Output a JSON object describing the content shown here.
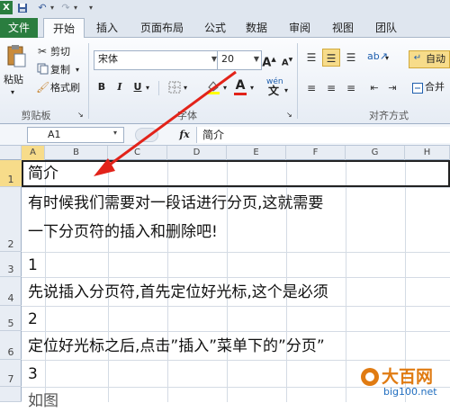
{
  "quick_access": {
    "excel_logo": "X",
    "undo": "↶",
    "redo": "↷",
    "dropdown": "▾"
  },
  "tabs": [
    "文件",
    "开始",
    "插入",
    "页面布局",
    "公式",
    "数据",
    "审阅",
    "视图",
    "团队"
  ],
  "active_tab": "开始",
  "clipboard": {
    "paste_label": "粘贴",
    "cut_label": "剪切",
    "copy_label": "复制",
    "format_painter_label": "格式刷",
    "group_label": "剪贴板"
  },
  "font": {
    "font_name": "宋体",
    "font_size": "20",
    "group_label": "字体",
    "bold": "B",
    "italic": "I",
    "underline": "U",
    "grow_font": "A",
    "shrink_font": "A",
    "font_color_letter": "A",
    "phonetic": "wén"
  },
  "alignment": {
    "group_label": "对齐方式",
    "wrap_label": "自动",
    "merge_label": "合并"
  },
  "formula_bar": {
    "name_box": "A1",
    "fx_label": "fx",
    "content": "简介"
  },
  "columns": [
    "A",
    "B",
    "C",
    "D",
    "E",
    "F",
    "G",
    "H"
  ],
  "rows": [
    {
      "number": "1",
      "text": "简介"
    },
    {
      "number": "2",
      "text": "有时候我们需要对一段话进行分页,这就需要"
    },
    {
      "number": "",
      "text": "一下分页符的插入和删除吧!"
    },
    {
      "number": "3",
      "text": "1"
    },
    {
      "number": "4",
      "text": "先说插入分页符,首先定位好光标,这个是必须"
    },
    {
      "number": "5",
      "text": "2"
    },
    {
      "number": "6",
      "text": "定位好光标之后,点击”插入”菜单下的”分页”"
    },
    {
      "number": "7",
      "text": "3"
    }
  ],
  "watermark": {
    "name": "大百网",
    "url": "big100.net"
  },
  "colors": {
    "file_tab": "#2a7d3f",
    "ribbon_bg": "#e6ecf4",
    "arrow": "#e2231a",
    "watermark": "#e07b12"
  }
}
